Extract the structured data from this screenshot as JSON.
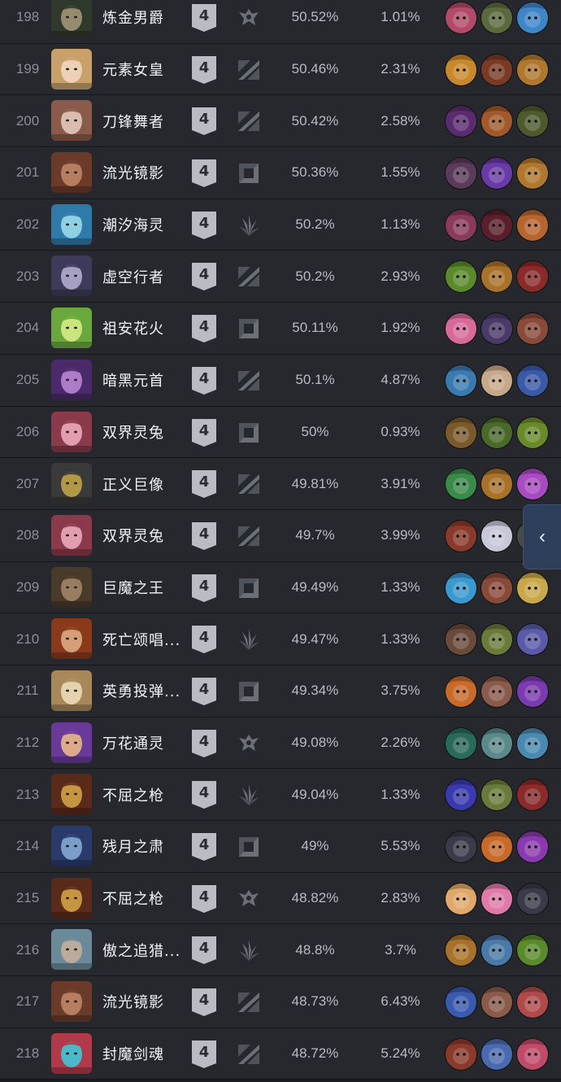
{
  "collapse_glyph": "‹",
  "rows": [
    {
      "rank": "198",
      "name": "炼金男爵",
      "tier": "4",
      "role": "support-icon",
      "winrate": "50.52%",
      "pickrate": "1.01%",
      "portrait_color": "#2f3a2c",
      "portrait_accent": "#a89a7a",
      "counters": [
        "#b24a6a",
        "#5b6a3e",
        "#3f86c9"
      ]
    },
    {
      "rank": "199",
      "name": "元素女皇",
      "tier": "4",
      "role": "blade-icon",
      "winrate": "50.46%",
      "pickrate": "2.31%",
      "portrait_color": "#c9a06a",
      "portrait_accent": "#f3d9c4",
      "counters": [
        "#c8882b",
        "#7a3a24",
        "#b0772e"
      ]
    },
    {
      "rank": "200",
      "name": "刀锋舞者",
      "tier": "4",
      "role": "blade-icon",
      "winrate": "50.42%",
      "pickrate": "2.58%",
      "portrait_color": "#8a5a4a",
      "portrait_accent": "#e7cfc2",
      "counters": [
        "#5a2c6f",
        "#a2592a",
        "#4e5a2c"
      ]
    },
    {
      "rank": "201",
      "name": "流光镜影",
      "tier": "4",
      "role": "square-icon",
      "winrate": "50.36%",
      "pickrate": "1.55%",
      "portrait_color": "#6b3b2a",
      "portrait_accent": "#c38a6a",
      "counters": [
        "#5b3a5a",
        "#6a3aa8",
        "#b0772e"
      ]
    },
    {
      "rank": "202",
      "name": "潮汐海灵",
      "tier": "4",
      "role": "leaf-icon",
      "winrate": "50.2%",
      "pickrate": "1.13%",
      "portrait_color": "#2f7aa8",
      "portrait_accent": "#9fe1ee",
      "counters": [
        "#8a3a5a",
        "#5a1e2c",
        "#b7652e"
      ]
    },
    {
      "rank": "203",
      "name": "虚空行者",
      "tier": "4",
      "role": "blade-icon",
      "winrate": "50.2%",
      "pickrate": "2.93%",
      "portrait_color": "#3e3a5a",
      "portrait_accent": "#b8b4d6",
      "counters": [
        "#5a8a2c",
        "#a8722a",
        "#8a2a2a"
      ]
    },
    {
      "rank": "204",
      "name": "祖安花火",
      "tier": "4",
      "role": "square-icon",
      "winrate": "50.11%",
      "pickrate": "1.92%",
      "portrait_color": "#6aa83e",
      "portrait_accent": "#dbf08a",
      "counters": [
        "#d86a9a",
        "#4a3a6a",
        "#8a4a3a"
      ]
    },
    {
      "rank": "205",
      "name": "暗黑元首",
      "tier": "4",
      "role": "blade-icon",
      "winrate": "50.1%",
      "pickrate": "4.87%",
      "portrait_color": "#4a2a6a",
      "portrait_accent": "#c08ad8",
      "counters": [
        "#3a7ab0",
        "#c8a88a",
        "#3a5aa8"
      ]
    },
    {
      "rank": "206",
      "name": "双界灵兔",
      "tier": "4",
      "role": "square-icon",
      "winrate": "50%",
      "pickrate": "0.93%",
      "portrait_color": "#8a3a4a",
      "portrait_accent": "#f0b0c0",
      "counters": [
        "#7a5a2a",
        "#4a6a2a",
        "#6a8a2a"
      ]
    },
    {
      "rank": "207",
      "name": "正义巨像",
      "tier": "4",
      "role": "blade-icon",
      "winrate": "49.81%",
      "pickrate": "3.91%",
      "portrait_color": "#3a3a3a",
      "portrait_accent": "#c8a84a",
      "counters": [
        "#3a8a4a",
        "#a8722a",
        "#a84ac0"
      ]
    },
    {
      "rank": "208",
      "name": "双界灵兔",
      "tier": "4",
      "role": "blade-icon",
      "winrate": "49.7%",
      "pickrate": "3.99%",
      "portrait_color": "#8a3a4a",
      "portrait_accent": "#f0b0c0",
      "counters": [
        "#8a3a2a",
        "#c8c8d8",
        "#4a4a4a"
      ]
    },
    {
      "rank": "209",
      "name": "巨魔之王",
      "tier": "4",
      "role": "square-icon",
      "winrate": "49.49%",
      "pickrate": "1.33%",
      "portrait_color": "#4a3a2a",
      "portrait_accent": "#a88a6a",
      "counters": [
        "#3a9ad0",
        "#8a4a3a",
        "#c8a84a"
      ]
    },
    {
      "rank": "210",
      "name": "死亡颂唱...",
      "tier": "4",
      "role": "leaf-icon",
      "winrate": "49.47%",
      "pickrate": "1.33%",
      "portrait_color": "#8a3a1a",
      "portrait_accent": "#e0b08a",
      "counters": [
        "#6a4a3a",
        "#6a7a3a",
        "#5a5aa8"
      ]
    },
    {
      "rank": "211",
      "name": "英勇投弹...",
      "tier": "4",
      "role": "square-icon",
      "winrate": "49.34%",
      "pickrate": "3.75%",
      "portrait_color": "#a8885a",
      "portrait_accent": "#f0e0c0",
      "counters": [
        "#c86a2a",
        "#8a5a4a",
        "#7a3ab0"
      ]
    },
    {
      "rank": "212",
      "name": "万花通灵",
      "tier": "4",
      "role": "support-icon",
      "winrate": "49.08%",
      "pickrate": "2.26%",
      "portrait_color": "#6a3a9a",
      "portrait_accent": "#f0c08a",
      "counters": [
        "#2a6a5a",
        "#5a8a8a",
        "#4a8ab0"
      ]
    },
    {
      "rank": "213",
      "name": "不屈之枪",
      "tier": "4",
      "role": "leaf-icon",
      "winrate": "49.04%",
      "pickrate": "1.33%",
      "portrait_color": "#5a2a1a",
      "portrait_accent": "#d8a84a",
      "counters": [
        "#3a3ab0",
        "#6a7a3a",
        "#8a2a2a"
      ]
    },
    {
      "rank": "214",
      "name": "残月之肃",
      "tier": "4",
      "role": "square-icon",
      "winrate": "49%",
      "pickrate": "5.53%",
      "portrait_color": "#2a3a6a",
      "portrait_accent": "#8ab0d8",
      "counters": [
        "#3a3a4a",
        "#c86a2a",
        "#8a3ab0"
      ]
    },
    {
      "rank": "215",
      "name": "不屈之枪",
      "tier": "4",
      "role": "support-icon",
      "winrate": "48.82%",
      "pickrate": "2.83%",
      "portrait_color": "#5a2a1a",
      "portrait_accent": "#d8a84a",
      "counters": [
        "#e0a86a",
        "#e07aa8",
        "#3a3a4a"
      ]
    },
    {
      "rank": "216",
      "name": "傲之追猎...",
      "tier": "4",
      "role": "leaf-icon",
      "winrate": "48.8%",
      "pickrate": "3.7%",
      "portrait_color": "#6a8a9a",
      "portrait_accent": "#c8b09a",
      "counters": [
        "#a8722a",
        "#4a7aa8",
        "#5a8a2a"
      ]
    },
    {
      "rank": "217",
      "name": "流光镜影",
      "tier": "4",
      "role": "blade-icon",
      "winrate": "48.73%",
      "pickrate": "6.43%",
      "portrait_color": "#6b3b2a",
      "portrait_accent": "#c38a6a",
      "counters": [
        "#3a5ab0",
        "#8a5a4a",
        "#b04a4a"
      ]
    },
    {
      "rank": "218",
      "name": "封魔剑魂",
      "tier": "4",
      "role": "blade-icon",
      "winrate": "48.72%",
      "pickrate": "5.24%",
      "portrait_color": "#b03a4a",
      "portrait_accent": "#3ad0e0",
      "counters": [
        "#8a3a2a",
        "#4a6ab0",
        "#c04a6a"
      ]
    }
  ]
}
